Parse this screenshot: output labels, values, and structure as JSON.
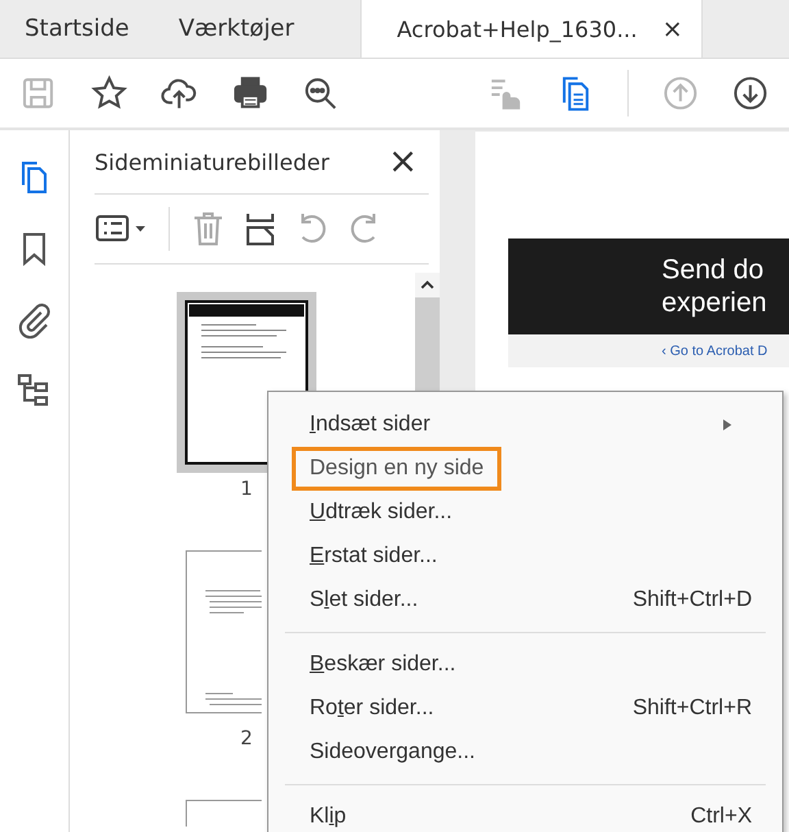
{
  "tabs": [
    {
      "label": "Startside",
      "selected": false
    },
    {
      "label": "Værktøjer",
      "selected": false
    },
    {
      "label": "Acrobat+Help_1630...",
      "selected": true,
      "close": "×"
    }
  ],
  "toolbar": [
    {
      "kind": "save",
      "disabled": true
    },
    {
      "kind": "star",
      "disabled": false
    },
    {
      "kind": "upload",
      "disabled": false
    },
    {
      "kind": "print",
      "disabled": false
    },
    {
      "kind": "search",
      "disabled": false
    },
    {
      "kind": "spacer"
    },
    {
      "kind": "hand",
      "disabled": true
    },
    {
      "kind": "pages",
      "disabled": false,
      "active": true
    },
    {
      "kind": "divider"
    },
    {
      "kind": "up",
      "disabled": true
    },
    {
      "kind": "down",
      "disabled": false
    }
  ],
  "rail": [
    {
      "kind": "pages",
      "selected": true
    },
    {
      "kind": "bookmark",
      "selected": false
    },
    {
      "kind": "clip",
      "selected": false
    },
    {
      "kind": "tree",
      "selected": false
    }
  ],
  "panel": {
    "title": "Sideminiaturebilleder",
    "close": "×",
    "tools": [
      {
        "kind": "options",
        "disabled": false
      },
      {
        "kind": "divider"
      },
      {
        "kind": "trash",
        "disabled": true
      },
      {
        "kind": "insert",
        "disabled": false
      },
      {
        "kind": "undo",
        "disabled": true
      },
      {
        "kind": "redo",
        "disabled": true
      }
    ],
    "thumbnails": [
      {
        "page": "1",
        "selected": true
      },
      {
        "page": "2",
        "selected": false
      },
      {
        "selected": false
      }
    ]
  },
  "document": {
    "banner": [
      "Send do",
      "experien"
    ],
    "link": "‹ Go to Acrobat D"
  },
  "menu": [
    {
      "key": "I",
      "post": "ndsæt sider",
      "submenu": true,
      "highlighted": false
    },
    {
      "pre": "Design en ny side",
      "highlighted": true
    },
    {
      "key": "U",
      "post": "dtræk sider...",
      "highlighted": false
    },
    {
      "key": "E",
      "post": "rstat sider...",
      "highlighted": false
    },
    {
      "pre": "S",
      "key": "l",
      "post": "et sider...",
      "shortcut": "Shift+Ctrl+D",
      "highlighted": false
    },
    {
      "kind": "separator"
    },
    {
      "key": "B",
      "post": "eskær sider...",
      "highlighted": false
    },
    {
      "pre": "Ro",
      "key": "t",
      "post": "er sider...",
      "shortcut": "Shift+Ctrl+R",
      "highlighted": false
    },
    {
      "pre": "Sideovergange...",
      "highlighted": false
    },
    {
      "kind": "separator"
    },
    {
      "pre": "Kl",
      "key": "i",
      "post": "p",
      "shortcut": "Ctrl+X",
      "highlighted": false
    }
  ]
}
